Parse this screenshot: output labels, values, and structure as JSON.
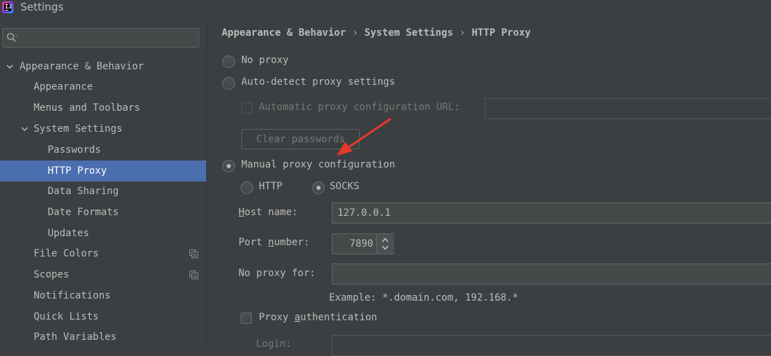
{
  "window": {
    "title": "Settings",
    "logo_text": "IJ"
  },
  "search": {
    "placeholder": "",
    "value": ""
  },
  "sidebar": {
    "items": [
      {
        "label": "Appearance & Behavior",
        "level": 0,
        "expanded": true
      },
      {
        "label": "Appearance",
        "level": 1
      },
      {
        "label": "Menus and Toolbars",
        "level": 1
      },
      {
        "label": "System Settings",
        "level": 1,
        "expanded": true
      },
      {
        "label": "Passwords",
        "level": 2
      },
      {
        "label": "HTTP Proxy",
        "level": 2,
        "selected": true
      },
      {
        "label": "Data Sharing",
        "level": 2
      },
      {
        "label": "Date Formats",
        "level": 2
      },
      {
        "label": "Updates",
        "level": 2
      },
      {
        "label": "File Colors",
        "level": 1,
        "icon": "copy-icon"
      },
      {
        "label": "Scopes",
        "level": 1,
        "icon": "copy-icon"
      },
      {
        "label": "Notifications",
        "level": 1
      },
      {
        "label": "Quick Lists",
        "level": 1
      },
      {
        "label": "Path Variables",
        "level": 1
      }
    ]
  },
  "breadcrumb": {
    "items": [
      "Appearance & Behavior",
      "System Settings",
      "HTTP Proxy"
    ],
    "separator": "›"
  },
  "proxy": {
    "no_proxy_label": "No proxy",
    "auto_detect_label": "Auto-detect proxy settings",
    "auto_config_url_label": "Automatic proxy configuration URL:",
    "auto_config_url_value": "",
    "clear_passwords_label": "Clear passwords",
    "manual_label": "Manual proxy configuration",
    "selected_mode": "manual",
    "http_label": "HTTP",
    "socks_label": "SOCKS",
    "selected_type": "SOCKS",
    "host_label_first": "H",
    "host_label_rest": "ost name:",
    "host_value": "127.0.0.1",
    "port_label_first": "Port ",
    "port_label_mnemonic": "n",
    "port_label_rest": "umber:",
    "port_value": "7890",
    "no_proxy_for_label": "No proxy for:",
    "no_proxy_for_value": "",
    "example_text": "Example: *.domain.com, 192.168.*",
    "auth_label_first": "Proxy ",
    "auth_label_mnemonic": "a",
    "auth_label_rest": "uthentication",
    "auth_checked": false,
    "login_label": "Login:"
  },
  "colors": {
    "background": "#3c3f41",
    "selection": "#4b6eaf",
    "text": "#bbbbbb",
    "annotation_arrow": "#e8382d"
  }
}
